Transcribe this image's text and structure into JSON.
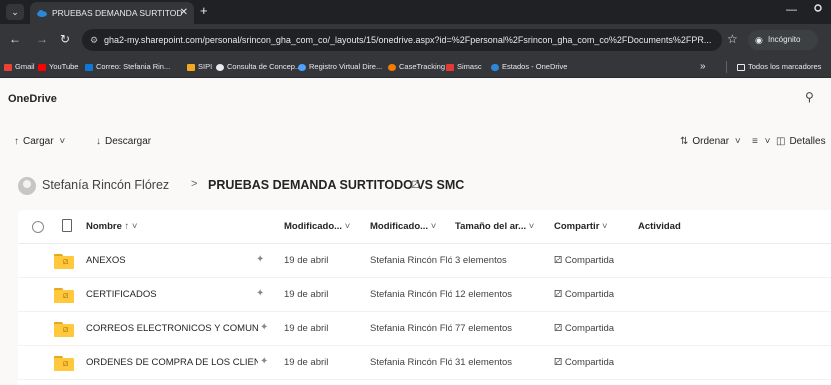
{
  "browser": {
    "menu_icon": "chevron-down",
    "tab_title": "PRUEBAS DEMANDA SURTITOD",
    "tab_close": "✕",
    "new_tab": "+",
    "minimize": "—",
    "close": "✕",
    "url": "gha2-my.sharepoint.com/personal/srincon_gha_com_co/_layouts/15/onedrive.aspx?id=%2Fpersonal%2Fsrincon_gha_com_co%2FDocuments%2FPR...",
    "incognito_label": "Incógnito",
    "bookmarks": [
      {
        "label": "Gmail",
        "color": "#ea4335"
      },
      {
        "label": "YouTube",
        "color": "#ff0000"
      },
      {
        "label": "Correo: Stefania Rin...",
        "color": "#0f78d4"
      },
      {
        "label": "SIPI",
        "color": "#f5a623"
      },
      {
        "label": "Consulta de Concep...",
        "color": "#e8eaed"
      },
      {
        "label": "Registro Virtual Dire...",
        "color": "#4ea3ff"
      },
      {
        "label": "CaseTracking",
        "color": "#f57c00"
      },
      {
        "label": "Simasc",
        "color": "#e53935"
      },
      {
        "label": "Estados - OneDrive",
        "color": "#2b88d8"
      }
    ],
    "bookmarks_overflow": "»",
    "all_bookmarks": "Todos los marcadores"
  },
  "app": {
    "title": "OneDrive"
  },
  "commands": {
    "upload": "Cargar",
    "download": "Descargar",
    "sort": "Ordenar",
    "details": "Detalles"
  },
  "breadcrumb": {
    "owner": "Stefanía Rincón Flórez",
    "separator": ">",
    "folder": "PRUEBAS DEMANDA SURTITODO VS SMC"
  },
  "table": {
    "columns": {
      "name": "Nombre",
      "modified": "Modificado...",
      "modified_by": "Modificado...",
      "size": "Tamaño del ar...",
      "sharing": "Compartir",
      "activity": "Actividad"
    },
    "rows": [
      {
        "name": "ANEXOS",
        "modified": "19 de abril",
        "modified_by": "Stefania Rincón Fló",
        "size": "3 elementos",
        "sharing": "Compartida"
      },
      {
        "name": "CERTIFICADOS",
        "modified": "19 de abril",
        "modified_by": "Stefania Rincón Fló",
        "size": "12 elementos",
        "sharing": "Compartida"
      },
      {
        "name": "CORREOS ELECTRONICOS Y COMUNIC...",
        "modified": "19 de abril",
        "modified_by": "Stefania Rincón Fló",
        "size": "77 elementos",
        "sharing": "Compartida"
      },
      {
        "name": "ORDENES DE COMPRA DE LOS CLIENT...",
        "modified": "19 de abril",
        "modified_by": "Stefania Rincón Fló",
        "size": "31 elementos",
        "sharing": "Compartida"
      }
    ]
  }
}
